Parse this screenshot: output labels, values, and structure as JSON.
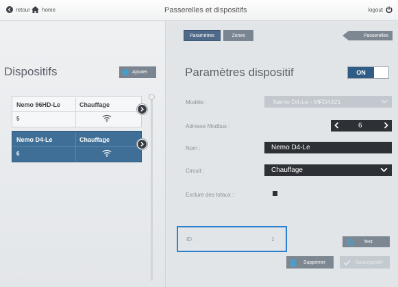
{
  "topbar": {
    "back_label": "retour",
    "home_label": "home",
    "title": "Passerelles et dispositifs",
    "logout_label": "logout"
  },
  "tabs": [
    {
      "label": "Paramètres",
      "active": true
    },
    {
      "label": "Zones",
      "active": false
    }
  ],
  "gateways_label": "Passerelles",
  "devices": {
    "title": "Dispositifs",
    "add_label": "Ajouter",
    "items": [
      {
        "name": "Nemo 96HD-Le",
        "type": "Chauffage",
        "address": "5",
        "signal_icon": "wifi-icon",
        "selected": false
      },
      {
        "name": "Nemo D4-Le",
        "type": "Chauffage",
        "address": "6",
        "signal_icon": "wifi-icon",
        "selected": true
      }
    ]
  },
  "params": {
    "title": "Paramètres dispositif",
    "toggle_label": "ON",
    "model_label": "Modèle :",
    "model_value": "Nemo D4-Le - MFD4421",
    "modbus_label": "Adresse Modbus :",
    "modbus_value": "6",
    "name_label": "Nom :",
    "name_value": "Nemo D4-Le",
    "circuit_label": "Circuit :",
    "circuit_value": "Chauffage",
    "exclude_label": "Exclure des totaux :",
    "id_label": "ID :",
    "id_value": "1"
  },
  "actions": {
    "test_label": "Test",
    "delete_label": "Supprimer",
    "save_label": "Sauvegarder"
  },
  "colors": {
    "accent": "#2f5d86",
    "selected_card": "#3f6f96",
    "highlight_border": "#2d7fd0",
    "plus_icon": "#3ea4d8"
  }
}
